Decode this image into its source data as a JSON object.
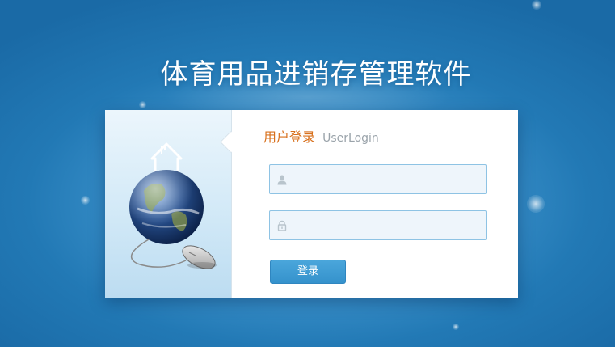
{
  "app": {
    "title": "体育用品进销存管理软件"
  },
  "login": {
    "heading_cn": "用户登录",
    "heading_en": "UserLogin",
    "username": {
      "value": "",
      "placeholder": "",
      "icon": "user-icon"
    },
    "password": {
      "value": "",
      "placeholder": "",
      "icon": "lock-icon"
    },
    "submit_label": "登录"
  },
  "colors": {
    "background": "#2279b5",
    "accent": "#3a98d1",
    "heading": "#d8701c",
    "field_border": "#8ec3e4",
    "field_bg": "#eef5fb"
  }
}
